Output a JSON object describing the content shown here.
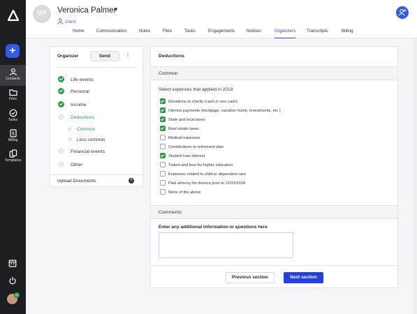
{
  "client": {
    "initials": "VP",
    "name": "Veronica Palmer",
    "type": "Client"
  },
  "tabs": [
    {
      "label": "Home"
    },
    {
      "label": "Communication"
    },
    {
      "label": "Notes"
    },
    {
      "label": "Files"
    },
    {
      "label": "Tasks"
    },
    {
      "label": "Engagements"
    },
    {
      "label": "Notices"
    },
    {
      "label": "Organizers",
      "active": true
    },
    {
      "label": "Transcripts"
    },
    {
      "label": "Billing"
    }
  ],
  "sidebar": {
    "items": [
      {
        "label": "Contacts",
        "icon": "contacts-icon",
        "active": true
      },
      {
        "label": "Files",
        "icon": "folder-icon"
      },
      {
        "label": "Tasks",
        "icon": "check-circle-icon"
      },
      {
        "label": "Billing",
        "icon": "dollar-icon"
      },
      {
        "label": "Templates",
        "icon": "templates-icon"
      }
    ],
    "avatar_badge": "M"
  },
  "organizer": {
    "title": "Organizer",
    "send_label": "Send",
    "steps": [
      {
        "label": "Life events",
        "status": "done"
      },
      {
        "label": "Personal",
        "status": "done"
      },
      {
        "label": "Income",
        "status": "done"
      },
      {
        "label": "Deductions",
        "status": "current"
      },
      {
        "label": "Common",
        "status": "current-sub"
      },
      {
        "label": "Less common",
        "status": "sub"
      },
      {
        "label": "Financial events",
        "status": "todo"
      },
      {
        "label": "Other",
        "status": "todo"
      }
    ],
    "upload_label": "Upload Documents"
  },
  "form": {
    "title": "Deductions",
    "section": "Common",
    "prompt": "Select expenses that applied in 2019",
    "options": [
      {
        "label": "Donations to charity (cash or non-cash)",
        "checked": true
      },
      {
        "label": "Interest payments (mortgage, vacation home, investments, etc.)",
        "checked": true
      },
      {
        "label": "State and local taxes",
        "checked": true
      },
      {
        "label": "Real estate taxes",
        "checked": true
      },
      {
        "label": "Medical expenses",
        "checked": false
      },
      {
        "label": "Contributions to retirement plan",
        "checked": false
      },
      {
        "label": "Student loan interest",
        "checked": true
      },
      {
        "label": "Tuition and fees for higher education",
        "checked": false
      },
      {
        "label": "Expenses related to child or dependent care",
        "checked": false
      },
      {
        "label": "Paid alimony for divorce prior to 12/31/2018",
        "checked": false
      },
      {
        "label": "None of the above",
        "checked": false
      }
    ],
    "comments_section": "Comments",
    "comments_label": "Enter any additional information or questions here",
    "comments_value": "",
    "prev_label": "Previous section",
    "next_label": "Next section"
  },
  "colors": {
    "accent": "#2341e0",
    "success": "#2e9b48",
    "sidebar": "#1d1e22"
  }
}
